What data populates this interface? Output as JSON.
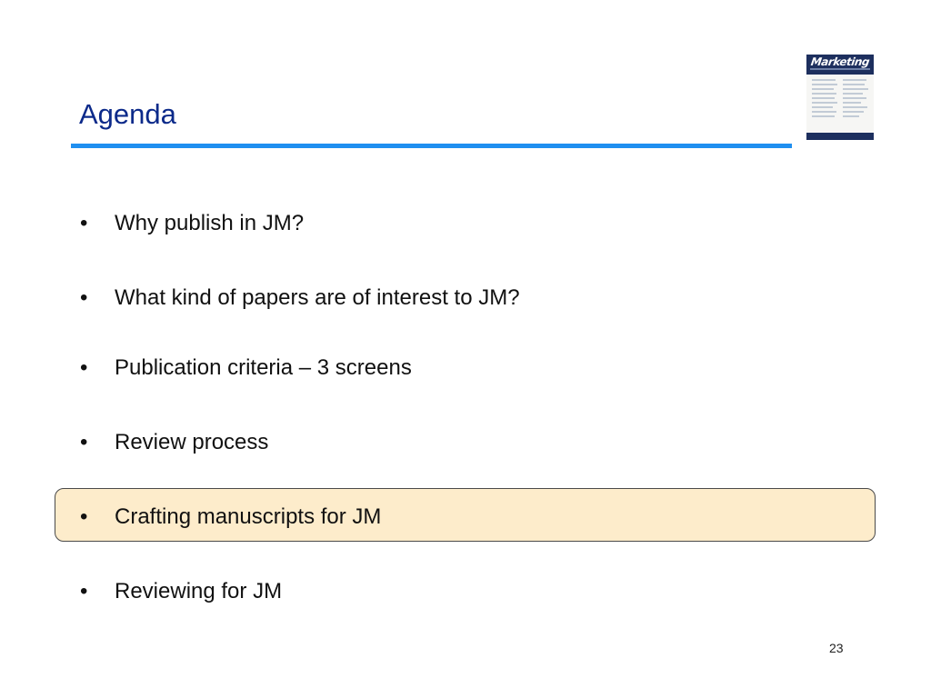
{
  "slide": {
    "title": "Agenda",
    "cover_thumbnail": {
      "brand": "Marketing",
      "colors": {
        "band": "#1d2f5e",
        "paper": "#f6f6f4"
      }
    },
    "bullet_glyph": "•",
    "items": [
      {
        "label": "Why publish in JM?"
      },
      {
        "label": "What kind of papers are of interest to JM?"
      },
      {
        "label": "Publication criteria – 3 screens"
      },
      {
        "label": "Review process"
      },
      {
        "label": "Crafting manuscripts for JM",
        "highlighted": true
      },
      {
        "label": "Reviewing for JM"
      }
    ],
    "page_number": "23",
    "colors": {
      "title": "#0c2a8a",
      "rule": "#1f8ff0",
      "highlight_fill": "#fdeccb",
      "highlight_border": "#4a4a4a"
    }
  }
}
